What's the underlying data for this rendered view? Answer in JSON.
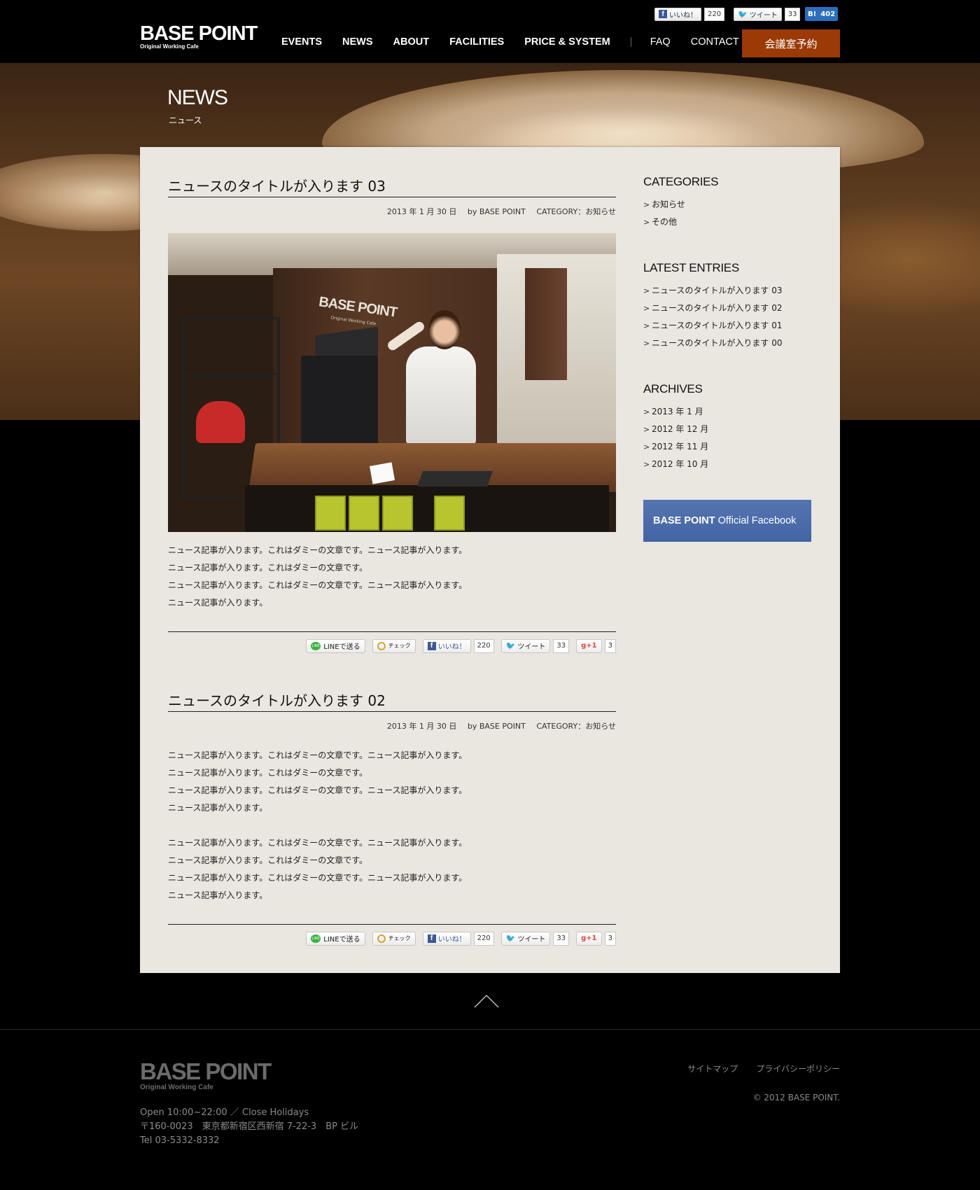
{
  "brand": {
    "logo_main": "BASE POINT",
    "logo_sub": "Original Working Cafe"
  },
  "nav": {
    "items": [
      "EVENTS",
      "NEWS",
      "ABOUT",
      "FACILITIES",
      "PRICE & SYSTEM"
    ],
    "secondary": [
      "FAQ",
      "CONTACT"
    ],
    "reserve_label": "会議室予約"
  },
  "social_top": {
    "like_label": "いいね！",
    "like_count": "220",
    "tweet_label": "ツイート",
    "tweet_count": "33",
    "hatena_label": "B!",
    "hatena_count": "402"
  },
  "hero": {
    "title": "NEWS",
    "subtitle": "ニュース"
  },
  "articles": [
    {
      "title": "ニュースのタイトルが入ります 03",
      "date": "2013 年 1 月 30 日",
      "author": "by BASE POINT",
      "category": "CATEGORY：お知らせ",
      "photo_text": "BASE POINT",
      "photo_subtext": "Original Working Cafe",
      "body": [
        "ニュース記事が入ります。これはダミーの文章です。ニュース記事が入ります。",
        "ニュース記事が入ります。これはダミーの文章です。",
        "ニュース記事が入ります。これはダミーの文章です。ニュース記事が入ります。",
        "ニュース記事が入ります。"
      ]
    },
    {
      "title": "ニュースのタイトルが入ります 02",
      "date": "2013 年 1 月 30 日",
      "author": "by BASE POINT",
      "category": "CATEGORY：お知らせ",
      "body": [
        "ニュース記事が入ります。これはダミーの文章です。ニュース記事が入ります。",
        "ニュース記事が入ります。これはダミーの文章です。",
        "ニュース記事が入ります。これはダミーの文章です。ニュース記事が入ります。",
        "ニュース記事が入ります。",
        "",
        "ニュース記事が入ります。これはダミーの文章です。ニュース記事が入ります。",
        "ニュース記事が入ります。これはダミーの文章です。",
        "ニュース記事が入ります。これはダミーの文章です。ニュース記事が入ります。",
        "ニュース記事が入ります。"
      ]
    }
  ],
  "share": {
    "line_label": "LINEで送る",
    "mixi_label": "チェック",
    "like_label": "いいね！",
    "like_count": "220",
    "tweet_label": "ツイート",
    "tweet_count": "33",
    "gplus_label": "+1",
    "gplus_count": "3"
  },
  "sidebar": {
    "categories_title": "CATEGORIES",
    "categories": [
      "お知らせ",
      "その他"
    ],
    "latest_title": "LATEST ENTRIES",
    "latest": [
      "ニュースのタイトルが入ります 03",
      "ニュースのタイトルが入ります 02",
      "ニュースのタイトルが入ります 01",
      "ニュースのタイトルが入ります 00"
    ],
    "archives_title": "ARCHIVES",
    "archives": [
      "2013 年 1 月",
      "2012 年 12 月",
      "2012 年 11 月",
      "2012 年 10 月"
    ],
    "facebook_bold": "BASE POINT",
    "facebook_rest": "Official Facebook"
  },
  "footer": {
    "logo_main": "BASE POINT",
    "logo_sub": "Original Working Cafe",
    "hours": "Open 10:00~22:00 ／ Close Holidays",
    "address": "〒160-0023　東京都新宿区西新宿 7-22-3　BP ビル",
    "tel": "Tel 03-5332-8332",
    "links": [
      "サイトマップ",
      "プライバシーポリシー"
    ],
    "copyright": "© 2012 BASE POINT."
  },
  "colors": {
    "accent": "#9b3a07",
    "panel": "#eae6e0",
    "facebook": "#4264a3"
  }
}
